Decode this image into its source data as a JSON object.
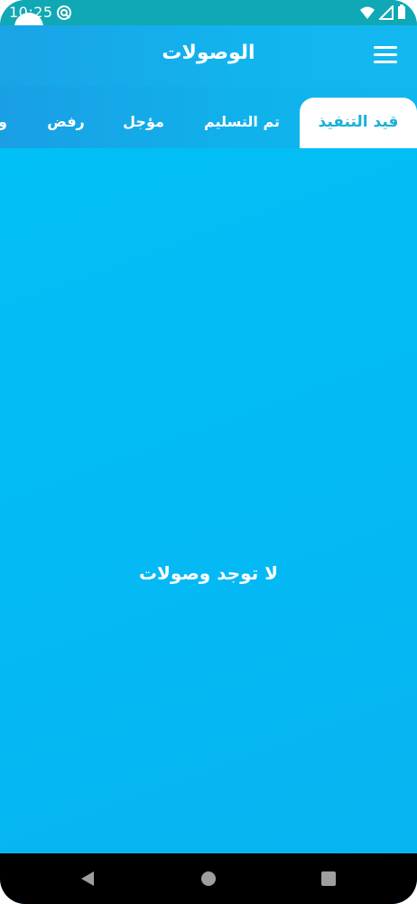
{
  "status_bar": {
    "time": "10:25",
    "icons": [
      "sync-icon",
      "wifi-icon",
      "cell-signal-icon",
      "battery-icon"
    ]
  },
  "app_bar": {
    "title": "الوصولات",
    "menu_icon": "menu-icon"
  },
  "tabs": [
    {
      "label": "قيد التنفيذ",
      "active": true
    },
    {
      "label": "تم التسليم",
      "active": false
    },
    {
      "label": "مؤجل",
      "active": false
    },
    {
      "label": "رفض",
      "active": false
    },
    {
      "label": "و",
      "active": false
    }
  ],
  "content": {
    "empty_message": "لا توجد وصولات"
  },
  "nav_bar": {
    "icons": [
      "back-icon",
      "home-icon",
      "recents-icon"
    ]
  },
  "colors": {
    "status_bar": "#10a8b4",
    "app_bar": "#12b4ee",
    "background": "#03bbf5",
    "active_tab_text": "#1ab0d8",
    "nav_bar": "#000000"
  }
}
